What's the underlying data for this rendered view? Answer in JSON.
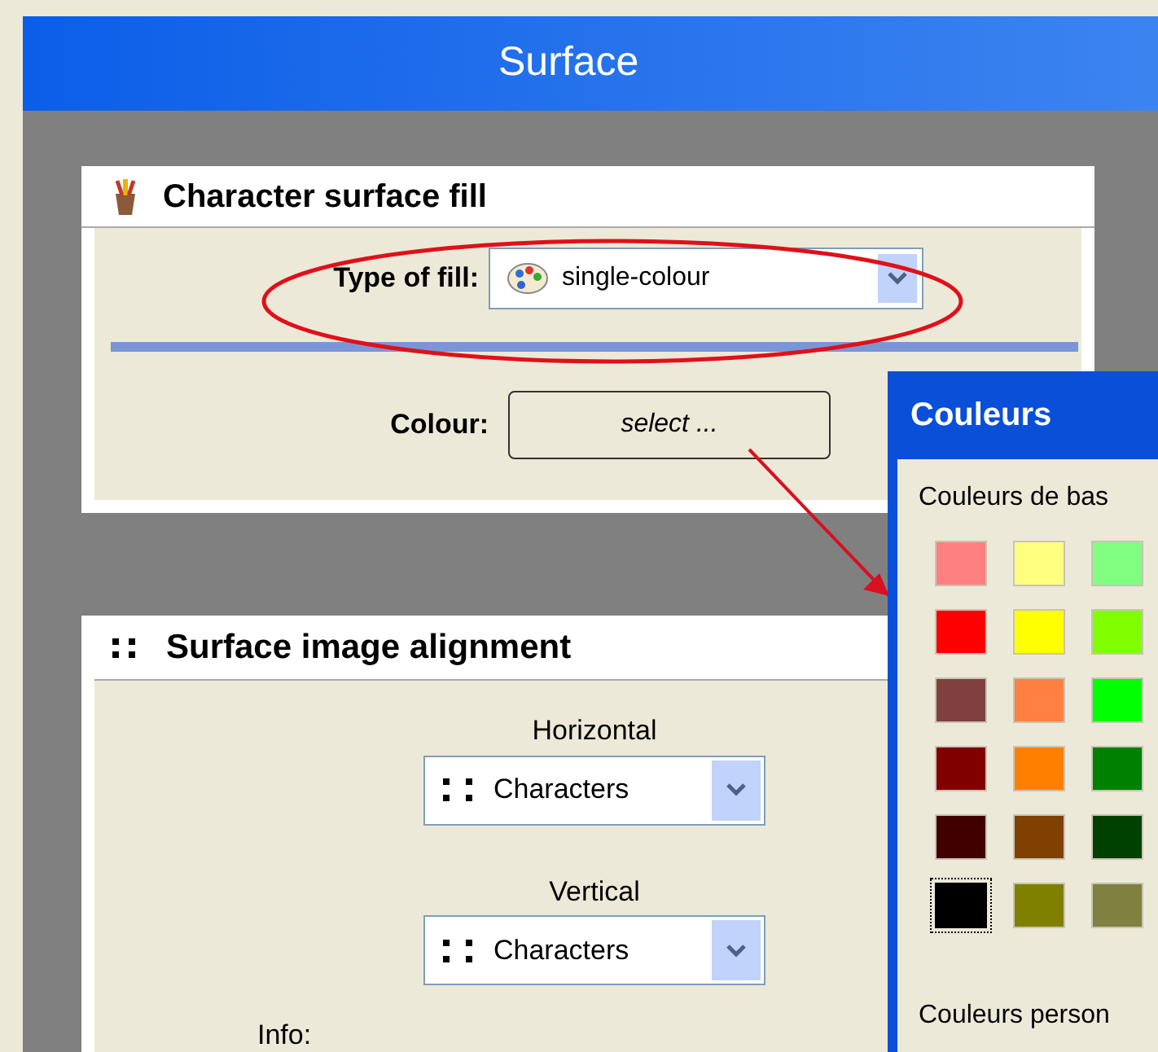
{
  "panel": {
    "title": "Surface"
  },
  "fill_card": {
    "title": "Character surface fill",
    "type_label": "Type of fill:",
    "type_value": "single-colour",
    "colour_label": "Colour:",
    "colour_button": "select ..."
  },
  "alignment_card": {
    "title": "Surface image alignment",
    "horizontal_label": "Horizontal",
    "horizontal_value": "Characters",
    "vertical_label": "Vertical",
    "vertical_value": "Characters",
    "info_label": "Info:"
  },
  "colour_dialog": {
    "title": "Couleurs",
    "basic_label": "Couleurs de bas",
    "custom_label": "Couleurs person",
    "swatches": [
      {
        "color": "#ff8080",
        "selected": false
      },
      {
        "color": "#ffff80",
        "selected": false
      },
      {
        "color": "#80ff80",
        "selected": false
      },
      {
        "color": "#ff0000",
        "selected": false
      },
      {
        "color": "#ffff00",
        "selected": false
      },
      {
        "color": "#80ff00",
        "selected": false
      },
      {
        "color": "#804040",
        "selected": false
      },
      {
        "color": "#ff8040",
        "selected": false
      },
      {
        "color": "#00ff00",
        "selected": false
      },
      {
        "color": "#800000",
        "selected": false
      },
      {
        "color": "#ff8000",
        "selected": false
      },
      {
        "color": "#008000",
        "selected": false
      },
      {
        "color": "#400000",
        "selected": false
      },
      {
        "color": "#804000",
        "selected": false
      },
      {
        "color": "#004000",
        "selected": false
      },
      {
        "color": "#000000",
        "selected": true
      },
      {
        "color": "#808000",
        "selected": false
      },
      {
        "color": "#808040",
        "selected": false
      }
    ]
  }
}
